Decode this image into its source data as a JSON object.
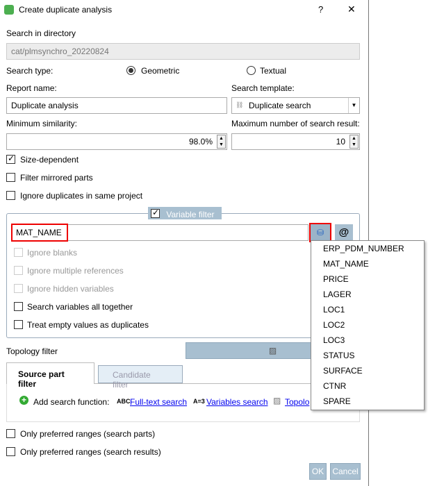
{
  "title": "Create duplicate analysis",
  "help": "?",
  "close": "✕",
  "dir_label": "Search in directory",
  "dir_value": "cat/plmsynchro_20220824",
  "search_type_label": "Search type:",
  "geometric": "Geometric",
  "textual": "Textual",
  "report_label": "Report name:",
  "report_value": "Duplicate analysis",
  "template_label": "Search template:",
  "template_value": "Duplicate search",
  "min_sim_label": "Minimum similarity:",
  "min_sim_value": "98.0%",
  "max_label": "Maximum number of search result:",
  "max_value": "10",
  "checks": [
    "Size-dependent",
    "Filter mirrored parts",
    "Ignore duplicates in same project"
  ],
  "var_filter": {
    "title": "Variable filter",
    "value": "MAT_NAME",
    "at": "@",
    "options": [
      "Ignore blanks",
      "Ignore multiple references",
      "Ignore hidden variables",
      "Search variables all together",
      "Treat empty values as duplicates"
    ]
  },
  "topology_label": "Topology filter",
  "tabs": [
    "Source part filter",
    "Candidate filter"
  ],
  "add_fn": "Add search function:",
  "abc": "ABC",
  "fulltext": "Full-text search",
  "a3": "A=3",
  "varsearch": "Variables search",
  "topo": "Topolo",
  "bottom_checks": [
    "Only preferred ranges (search parts)",
    "Only preferred ranges (search results)"
  ],
  "ok": "OK",
  "cancel": "Cancel",
  "menu": [
    "ERP_PDM_NUMBER",
    "MAT_NAME",
    "PRICE",
    "LAGER",
    "LOC1",
    "LOC2",
    "LOC3",
    "STATUS",
    "SURFACE",
    "CTNR",
    "SPARE"
  ]
}
